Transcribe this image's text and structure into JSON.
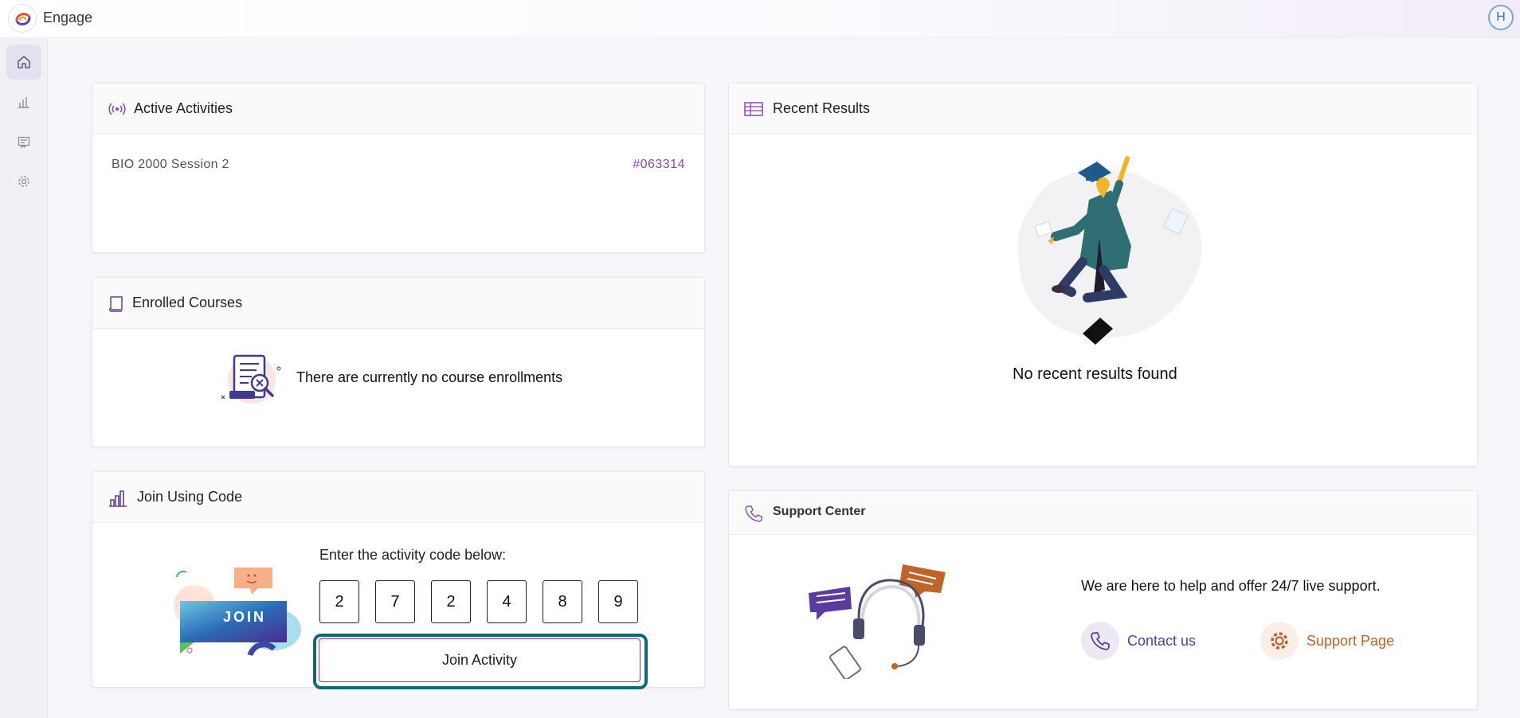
{
  "app": {
    "title": "Engage",
    "avatar_initial": "H"
  },
  "sidebar": {
    "items": [
      {
        "icon": "home-icon",
        "active": true
      },
      {
        "icon": "bar-chart-icon",
        "active": false
      },
      {
        "icon": "book-icon",
        "active": false
      },
      {
        "icon": "gear-icon",
        "active": false
      }
    ]
  },
  "active_activities": {
    "title": "Active Activities",
    "items": [
      {
        "name": "BIO 2000 Session 2",
        "code": "#063314"
      }
    ]
  },
  "enrolled_courses": {
    "title": "Enrolled Courses",
    "empty_message": "There are currently no course enrollments"
  },
  "join_using_code": {
    "title": "Join Using Code",
    "illustration_label": "JOIN",
    "prompt": "Enter the activity code below:",
    "digits": [
      "2",
      "7",
      "2",
      "4",
      "8",
      "9"
    ],
    "button_label": "Join Activity"
  },
  "recent_results": {
    "title": "Recent Results",
    "empty_message": "No recent results found"
  },
  "support_center": {
    "title": "Support Center",
    "message": "We are here to help and offer 24/7 live support.",
    "contact_label": "Contact us",
    "support_page_label": "Support Page"
  },
  "colors": {
    "accent_purple": "#8c4aa6",
    "link_purple": "#5b3c8f",
    "link_orange": "#b8642a",
    "focus_teal": "#0d6a7a"
  }
}
